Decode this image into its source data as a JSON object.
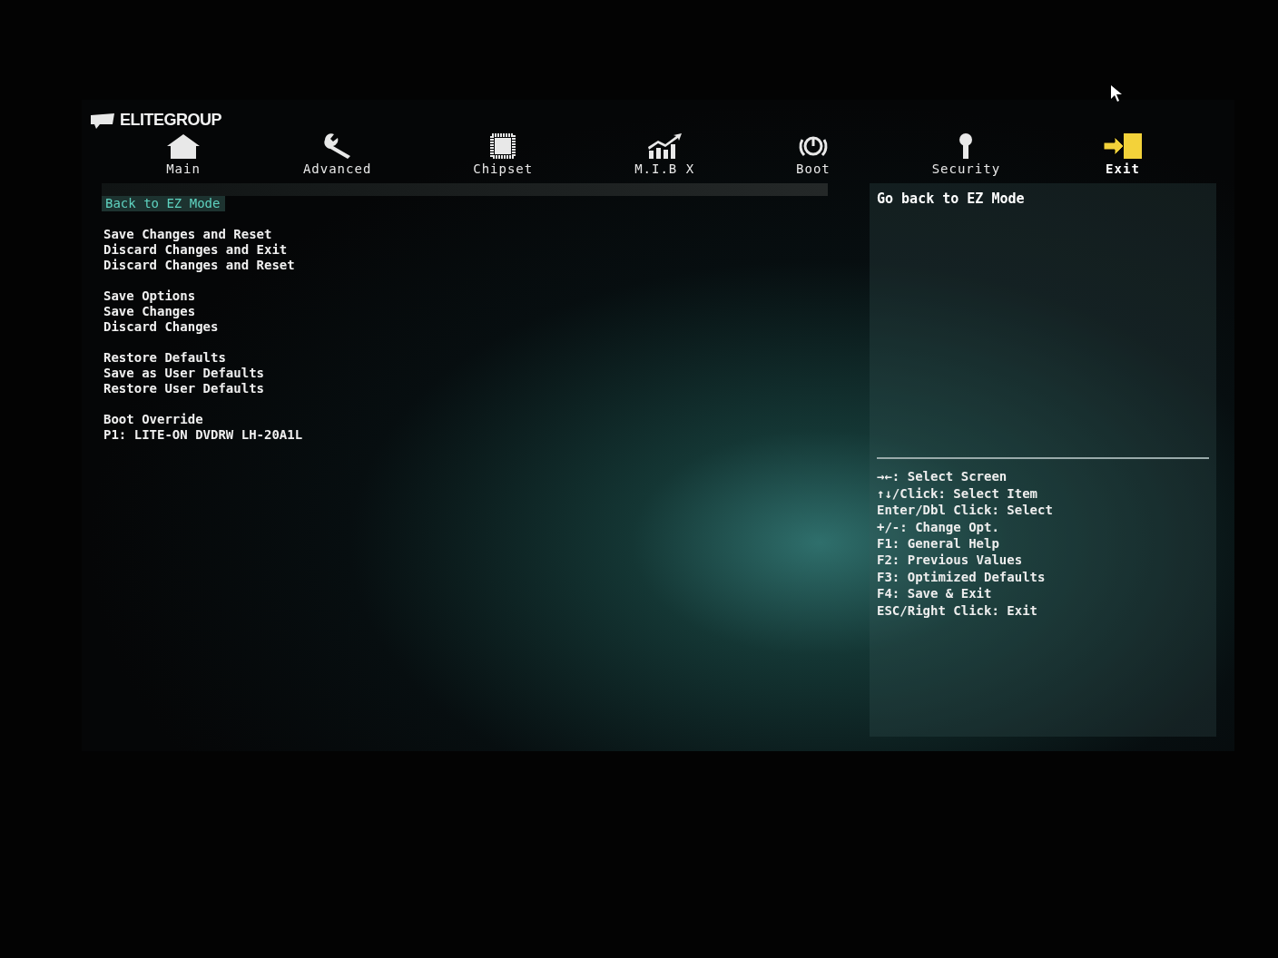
{
  "brand": "ELITEGROUP",
  "tabs": [
    {
      "label": "Main",
      "selected": false
    },
    {
      "label": "Advanced",
      "selected": false
    },
    {
      "label": "Chipset",
      "selected": false
    },
    {
      "label": "M.I.B X",
      "selected": false
    },
    {
      "label": "Boot",
      "selected": false
    },
    {
      "label": "Security",
      "selected": false
    },
    {
      "label": "Exit",
      "selected": true
    }
  ],
  "menu_groups": [
    [
      {
        "label": "Back to EZ Mode",
        "selected": true
      }
    ],
    [
      {
        "label": "Save Changes and Reset",
        "selected": false
      },
      {
        "label": "Discard Changes and Exit",
        "selected": false
      },
      {
        "label": "Discard Changes and Reset",
        "selected": false
      }
    ],
    [
      {
        "label": "Save Options",
        "selected": false
      },
      {
        "label": "Save Changes",
        "selected": false
      },
      {
        "label": "Discard Changes",
        "selected": false
      }
    ],
    [
      {
        "label": "Restore Defaults",
        "selected": false
      },
      {
        "label": "Save as User Defaults",
        "selected": false
      },
      {
        "label": "Restore User Defaults",
        "selected": false
      }
    ],
    [
      {
        "label": "Boot Override",
        "selected": false
      },
      {
        "label": "P1: LITE-ON DVDRW LH-20A1L",
        "selected": false
      }
    ]
  ],
  "help_text": "Go back to EZ Mode",
  "key_hints": [
    "→←: Select Screen",
    "↑↓/Click: Select Item",
    "Enter/Dbl Click: Select",
    "+/-: Change Opt.",
    "F1: General Help",
    "F2: Previous Values",
    "F3: Optimized Defaults",
    "F4: Save & Exit",
    "ESC/Right Click: Exit"
  ]
}
